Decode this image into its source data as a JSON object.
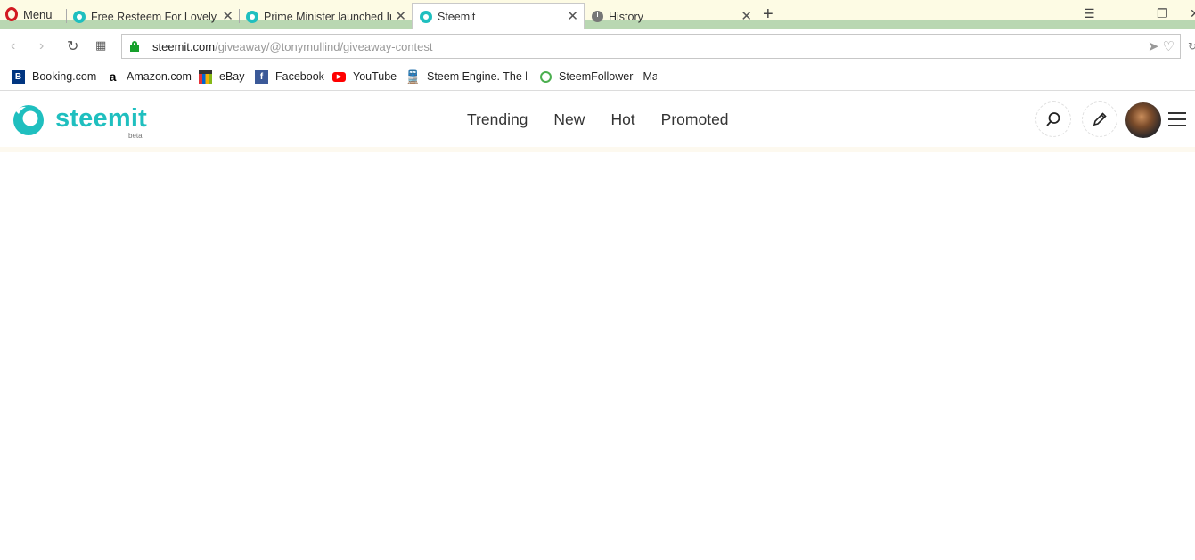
{
  "browser": {
    "menu_label": "Menu",
    "tabs": [
      {
        "title": "Free Resteem For Lovely Pu",
        "icon": "steemit-favicon-icon",
        "active": false
      },
      {
        "title": "Prime Minister launched In",
        "icon": "steemit-favicon-icon",
        "active": false
      },
      {
        "title": "Steemit",
        "icon": "steemit-favicon-icon",
        "active": true
      },
      {
        "title": "History",
        "icon": "clock-icon",
        "active": false
      }
    ],
    "address": {
      "domain": "steemit.com",
      "path": "/giveaway/@tonymullind/giveaway-contest"
    },
    "bookmarks": [
      {
        "label": "Booking.com",
        "icon": "booking-icon",
        "color": "#003580"
      },
      {
        "label": "Amazon.com",
        "icon": "amazon-icon",
        "color": "#000000"
      },
      {
        "label": "eBay",
        "icon": "ebay-icon",
        "color": "#e53238"
      },
      {
        "label": "Facebook",
        "icon": "facebook-icon",
        "color": "#3b5998"
      },
      {
        "label": "YouTube",
        "icon": "youtube-icon",
        "color": "#ff0000"
      },
      {
        "label": "Steem Engine. The be",
        "icon": "train-icon",
        "color": "#333333"
      },
      {
        "label": "SteemFollower - Mar",
        "icon": "steemfollower-icon",
        "color": "#4caf50"
      }
    ]
  },
  "site": {
    "logo_text": "steemit",
    "logo_badge": "beta",
    "brand_color": "#1fbfbf",
    "nav": [
      "Trending",
      "New",
      "Hot",
      "Promoted"
    ]
  }
}
